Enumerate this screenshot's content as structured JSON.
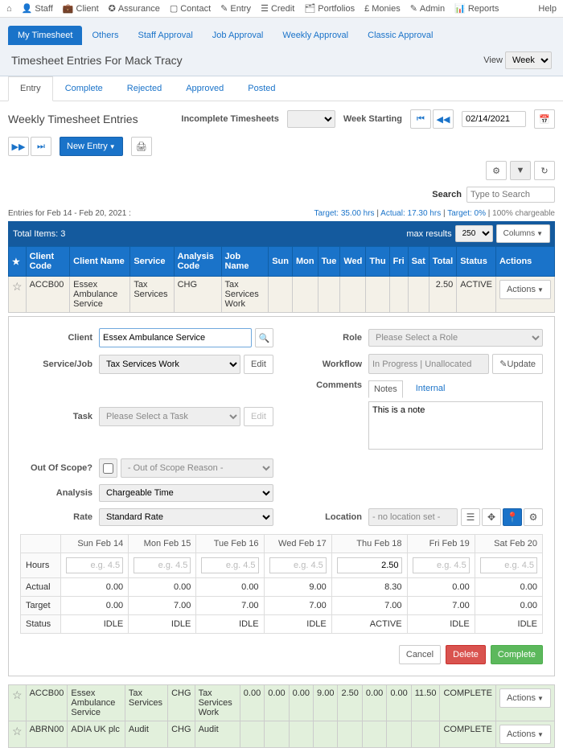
{
  "topnav": {
    "items": [
      "Staff",
      "Client",
      "Assurance",
      "Contact",
      "Entry",
      "Credit",
      "Portfolios",
      "Monies",
      "Admin",
      "Reports"
    ],
    "help": "Help"
  },
  "secnav": {
    "tabs": [
      "My Timesheet",
      "Others",
      "Staff Approval",
      "Job Approval",
      "Weekly Approval",
      "Classic Approval"
    ],
    "active": 0
  },
  "titlebar": {
    "title": "Timesheet Entries For Mack Tracy",
    "view_label": "View",
    "view_value": "Week"
  },
  "subtabs": {
    "tabs": [
      "Entry",
      "Complete",
      "Rejected",
      "Approved",
      "Posted"
    ],
    "active": 0
  },
  "panel": {
    "heading": "Weekly Timesheet Entries",
    "incomplete_label": "Incomplete Timesheets",
    "weekstart_label": "Week Starting",
    "weekstart_value": "02/14/2021",
    "new_entry": "New Entry"
  },
  "search": {
    "label": "Search",
    "placeholder": "Type to Search"
  },
  "summary": {
    "left": "Entries for Feb 14 - Feb 20, 2021 :",
    "target": "Target: 35.00 hrs",
    "actual": "Actual: 17.30 hrs",
    "tpct": "Target: 0%",
    "chg": "100% chargeable"
  },
  "bluebar": {
    "total": "Total Items: 3",
    "maxres": "max results",
    "maxres_val": "250",
    "columns": "Columns"
  },
  "headers": [
    "Client Code",
    "Client Name",
    "Service",
    "Analysis Code",
    "Job Name",
    "Sun",
    "Mon",
    "Tue",
    "Wed",
    "Thu",
    "Fri",
    "Sat",
    "Total",
    "Status",
    "Actions"
  ],
  "rows": [
    {
      "code": "ACCB00",
      "client": "Essex Ambulance Service",
      "service": "Tax Services",
      "acode": "CHG",
      "job": "Tax Services Work",
      "days": [
        "",
        "",
        "",
        "",
        "",
        "",
        ""
      ],
      "total": "2.50",
      "status": "ACTIVE",
      "cls": "beige"
    }
  ],
  "rows2": [
    {
      "code": "ACCB00",
      "client": "Essex Ambulance Service",
      "service": "Tax Services",
      "acode": "CHG",
      "job": "Tax Services Work",
      "days": [
        "0.00",
        "0.00",
        "0.00",
        "9.00",
        "2.50",
        "0.00",
        "0.00"
      ],
      "total": "11.50",
      "status": "COMPLETE",
      "cls": "green"
    },
    {
      "code": "ABRN00",
      "client": "ADIA UK plc",
      "service": "Audit",
      "acode": "CHG",
      "job": "Audit",
      "days": [
        "",
        "",
        "",
        "",
        "",
        "",
        ""
      ],
      "total": "",
      "status": "COMPLETE",
      "cls": "green"
    }
  ],
  "form": {
    "client_label": "Client",
    "client_value": "Essex Ambulance Service",
    "servicejob_label": "Service/Job",
    "servicejob_value": "Tax Services Work",
    "edit": "Edit",
    "task_label": "Task",
    "task_value": "Please Select a Task",
    "oos_label": "Out Of Scope?",
    "oos_reason": "- Out of Scope Reason -",
    "analysis_label": "Analysis",
    "analysis_value": "Chargeable Time",
    "rate_label": "Rate",
    "rate_value": "Standard Rate",
    "role_label": "Role",
    "role_value": "Please Select a Role",
    "workflow_label": "Workflow",
    "workflow_value": "In Progress | Unallocated",
    "update": "Update",
    "comments_label": "Comments",
    "notes": "Notes",
    "internal": "Internal",
    "notes_text": "This is a note",
    "location_label": "Location",
    "location_value": "- no location set -"
  },
  "daygrid": {
    "days": [
      "Sun Feb 14",
      "Mon Feb 15",
      "Tue Feb 16",
      "Wed Feb 17",
      "Thu Feb 18",
      "Fri Feb 19",
      "Sat Feb 20"
    ],
    "hours_label": "Hours",
    "hours": [
      "",
      "",
      "",
      "",
      "2.50",
      "",
      ""
    ],
    "placeholder": "e.g. 4.5",
    "actual_label": "Actual",
    "actual": [
      "0.00",
      "0.00",
      "0.00",
      "9.00",
      "8.30",
      "0.00",
      "0.00"
    ],
    "target_label": "Target",
    "target": [
      "0.00",
      "7.00",
      "7.00",
      "7.00",
      "7.00",
      "7.00",
      "0.00"
    ],
    "status_label": "Status",
    "status": [
      "IDLE",
      "IDLE",
      "IDLE",
      "IDLE",
      "ACTIVE",
      "IDLE",
      "IDLE"
    ]
  },
  "actions": {
    "cancel": "Cancel",
    "delete": "Delete",
    "complete": "Complete",
    "row_action": "Actions"
  }
}
